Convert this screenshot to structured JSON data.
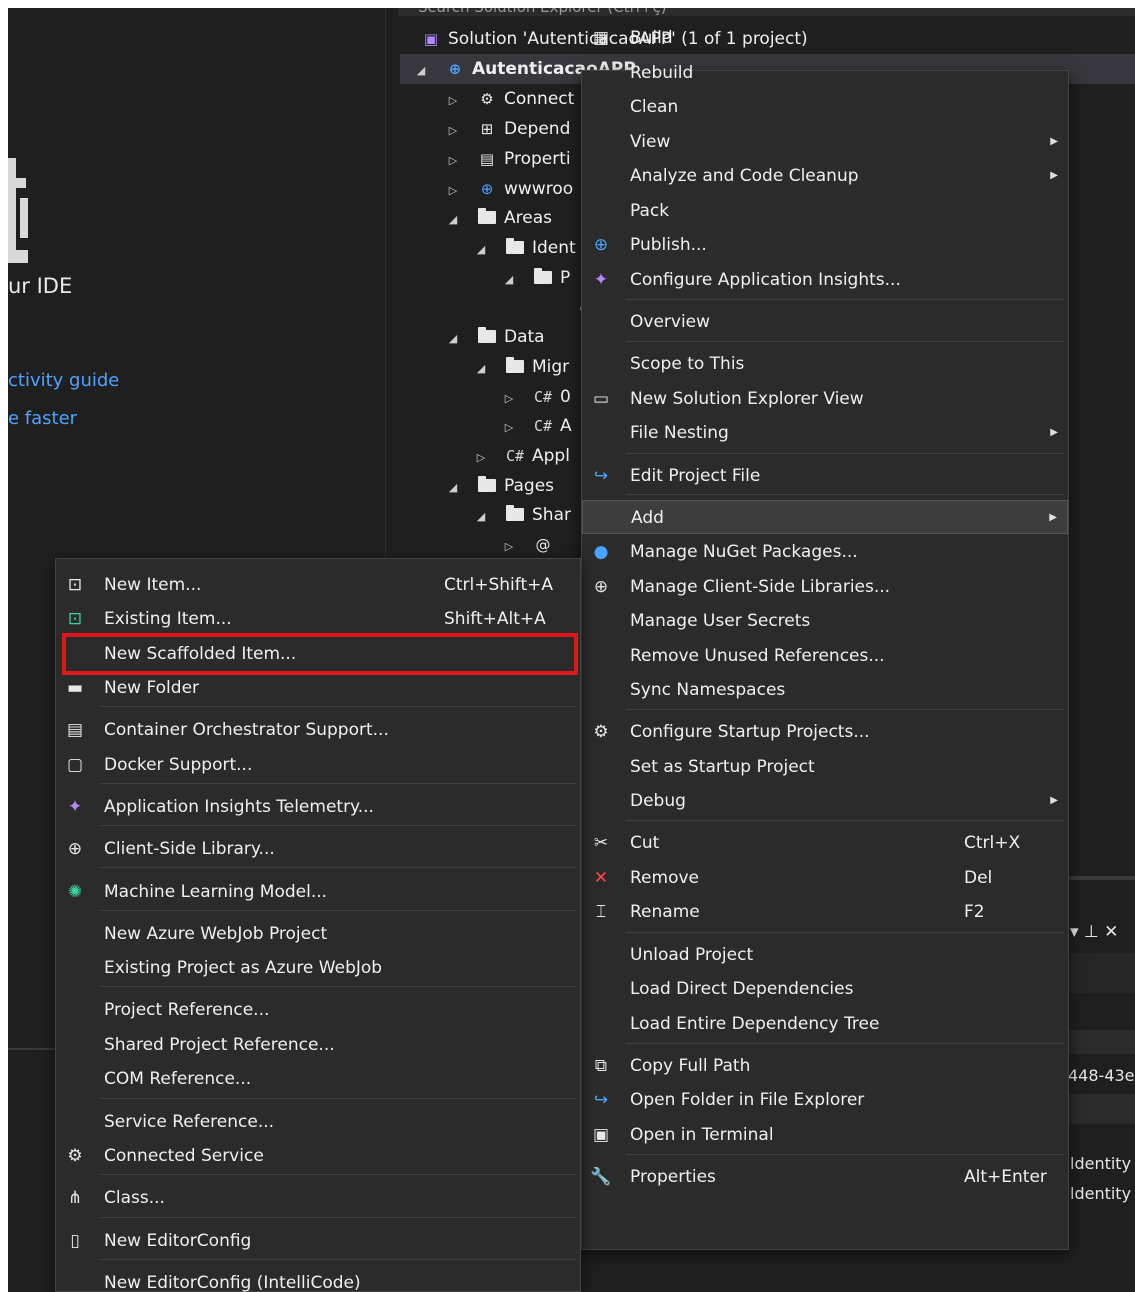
{
  "start_page": {
    "heading_fragment": "ur IDE",
    "link1": "ctivity guide",
    "link2": "e faster"
  },
  "solution_explorer": {
    "search_placeholder": "Search Solution Explorer (Ctrl+ç)",
    "solution_label": "Solution 'AutenticacaoAPP' (1 of 1 project)",
    "project_label": "AutenticacaoAPP",
    "tree": [
      {
        "text": "Connect",
        "icon": "connected-services-icon"
      },
      {
        "text": "Depend",
        "icon": "dependencies-icon"
      },
      {
        "text": "Properti",
        "icon": "properties-icon"
      },
      {
        "text": "wwwroo",
        "icon": "globe-icon"
      },
      {
        "text": "Areas",
        "icon": "folder-icon"
      },
      {
        "text": "Ident",
        "icon": "folder-icon"
      },
      {
        "text": "P",
        "icon": "folder-icon"
      },
      {
        "text": "",
        "icon": "razor-file-icon"
      },
      {
        "text": "Data",
        "icon": "folder-icon"
      },
      {
        "text": "Migr",
        "icon": "folder-icon"
      },
      {
        "text": "0",
        "icon": "csharp-icon"
      },
      {
        "text": "A",
        "icon": "csharp-icon"
      },
      {
        "text": "Appl",
        "icon": "csharp-icon"
      },
      {
        "text": "Pages",
        "icon": "folder-icon"
      },
      {
        "text": "Shar",
        "icon": "folder-icon"
      },
      {
        "text": "",
        "icon": "razor-file-icon"
      }
    ]
  },
  "project_menu": {
    "items": [
      {
        "label": "Build",
        "icon": "build-icon"
      },
      {
        "label": "Rebuild"
      },
      {
        "label": "Clean"
      },
      {
        "label": "View",
        "submenu": true
      },
      {
        "label": "Analyze and Code Cleanup",
        "submenu": true
      },
      {
        "label": "Pack"
      },
      {
        "label": "Publish...",
        "icon": "publish-icon"
      },
      {
        "label": "Configure Application Insights...",
        "icon": "app-insights-icon"
      },
      {
        "label": "Overview"
      },
      {
        "label": "Scope to This"
      },
      {
        "label": "New Solution Explorer View",
        "icon": "new-view-icon"
      },
      {
        "label": "File Nesting",
        "submenu": true
      },
      {
        "label": "Edit Project File",
        "icon": "edit-project-icon"
      },
      {
        "label": "Add",
        "submenu": true
      },
      {
        "label": "Manage NuGet Packages...",
        "icon": "nuget-icon"
      },
      {
        "label": "Manage Client-Side Libraries...",
        "icon": "client-library-icon"
      },
      {
        "label": "Manage User Secrets"
      },
      {
        "label": "Remove Unused References..."
      },
      {
        "label": "Sync Namespaces"
      },
      {
        "label": "Configure Startup Projects...",
        "icon": "gear-icon"
      },
      {
        "label": "Set as Startup Project"
      },
      {
        "label": "Debug",
        "submenu": true
      },
      {
        "label": "Cut",
        "icon": "cut-icon",
        "shortcut": "Ctrl+X"
      },
      {
        "label": "Remove",
        "icon": "remove-icon",
        "shortcut": "Del"
      },
      {
        "label": "Rename",
        "icon": "rename-icon",
        "shortcut": "F2"
      },
      {
        "label": "Unload Project"
      },
      {
        "label": "Load Direct Dependencies"
      },
      {
        "label": "Load Entire Dependency Tree"
      },
      {
        "label": "Copy Full Path",
        "icon": "copy-icon"
      },
      {
        "label": "Open Folder in File Explorer",
        "icon": "open-folder-icon"
      },
      {
        "label": "Open in Terminal",
        "icon": "terminal-icon"
      },
      {
        "label": "Properties",
        "icon": "wrench-icon",
        "shortcut": "Alt+Enter"
      }
    ]
  },
  "add_menu": {
    "items": [
      {
        "label": "New Item...",
        "icon": "new-item-icon",
        "shortcut": "Ctrl+Shift+A"
      },
      {
        "label": "Existing Item...",
        "icon": "existing-item-icon",
        "shortcut": "Shift+Alt+A"
      },
      {
        "label": "New Scaffolded Item..."
      },
      {
        "label": "New Folder",
        "icon": "new-folder-icon"
      },
      {
        "label": "Container Orchestrator Support...",
        "icon": "container-icon"
      },
      {
        "label": "Docker Support...",
        "icon": "docker-icon"
      },
      {
        "label": "Application Insights Telemetry...",
        "icon": "app-insights-icon"
      },
      {
        "label": "Client-Side Library...",
        "icon": "client-library-icon"
      },
      {
        "label": "Machine Learning Model...",
        "icon": "ml-model-icon"
      },
      {
        "label": "New Azure WebJob Project"
      },
      {
        "label": "Existing Project as Azure WebJob"
      },
      {
        "label": "Project Reference..."
      },
      {
        "label": "Shared Project Reference..."
      },
      {
        "label": "COM Reference..."
      },
      {
        "label": "Service Reference..."
      },
      {
        "label": "Connected Service",
        "icon": "connected-services-icon"
      },
      {
        "label": "Class...",
        "icon": "class-icon"
      },
      {
        "label": "New EditorConfig",
        "icon": "file-icon"
      },
      {
        "label": "New EditorConfig (IntelliCode)"
      }
    ]
  },
  "bottom_fragments": {
    "pin_controls": "▾ ⊥ ✕",
    "guid_fragment": "448-43e",
    "identity1": "ldentity",
    "identity2": "ldentity"
  },
  "colors": {
    "highlight": "#e0161d",
    "menu_bg": "#2b2b2b",
    "ide_bg": "#1f1f1f",
    "link": "#4fa3ff"
  }
}
